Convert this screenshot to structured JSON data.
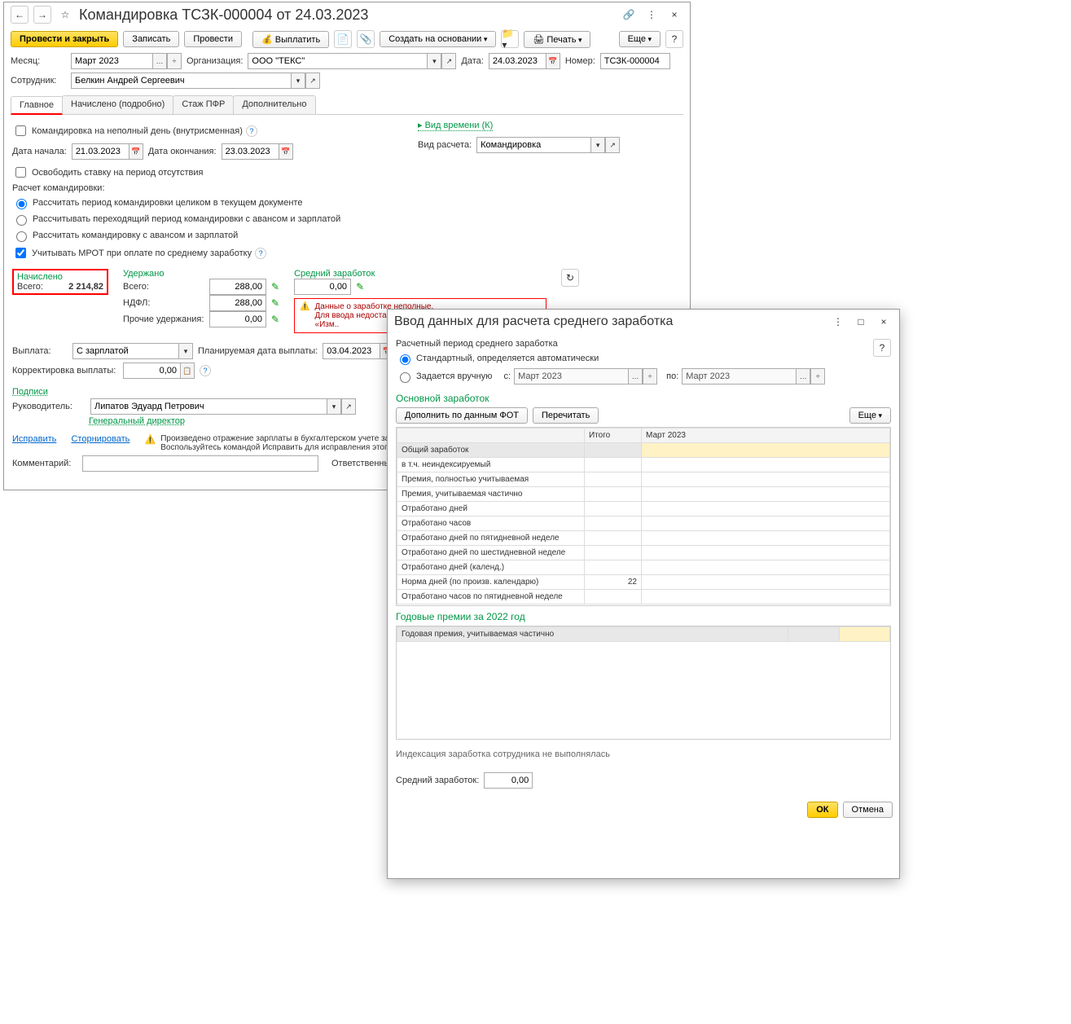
{
  "win1": {
    "title": "Командировка ТСЗК-000004 от 24.03.2023",
    "toolbar": {
      "post_close": "Провести и закрыть",
      "save": "Записать",
      "post": "Провести",
      "pay": "Выплатить",
      "create_based": "Создать на основании",
      "print": "Печать",
      "more": "Еще"
    },
    "header": {
      "month_lbl": "Месяц:",
      "month": "Март 2023",
      "org_lbl": "Организация:",
      "org": "ООО \"ТЕКС\"",
      "date_lbl": "Дата:",
      "date": "24.03.2023",
      "num_lbl": "Номер:",
      "num": "ТСЗК-000004",
      "emp_lbl": "Сотрудник:",
      "emp": "Белкин Андрей Сергеевич"
    },
    "tabs": [
      "Главное",
      "Начислено (подробно)",
      "Стаж ПФР",
      "Дополнительно"
    ],
    "main": {
      "partial_day": "Командировка на неполный день (внутрисменная)",
      "start_lbl": "Дата начала:",
      "start": "21.03.2023",
      "end_lbl": "Дата окончания:",
      "end": "23.03.2023",
      "vac_release": "Освободить ставку на период отсутствия",
      "calc_lbl": "Расчет командировки:",
      "r1": "Рассчитать период командировки целиком в текущем документе",
      "r2": "Рассчитывать переходящий период командировки с авансом и зарплатой",
      "r3": "Рассчитать командировку с авансом и зарплатой",
      "mrot": "Учитывать МРОТ при оплате по среднему заработку",
      "time_type_lbl": "Вид времени (К)",
      "calc_type_lbl": "Вид расчета:",
      "calc_type": "Командировка",
      "accrued": "Начислено",
      "held": "Удержано",
      "avg": "Средний заработок",
      "total_lbl": "Всего:",
      "accrued_val": "2 214,82",
      "held_total": "288,00",
      "ndfl_lbl": "НДФЛ:",
      "ndfl": "288,00",
      "other_lbl": "Прочие удержания:",
      "other": "0,00",
      "avg_val": "0,00",
      "warn1": "Данные о заработке неполные.",
      "warn2": "Для ввода недостающих данных используйте команду «Изм..",
      "payout_lbl": "Выплата:",
      "payout": "С зарплатой",
      "plan_date_lbl": "Планируемая дата выплаты:",
      "plan_date": "03.04.2023",
      "corr_lbl": "Корректировка выплаты:",
      "corr": "0,00",
      "sign_lbl": "Подписи",
      "head_lbl": "Руководитель:",
      "head": "Липатов Эдуард Петрович",
      "head_pos": "Генеральный директор",
      "fix": "Исправить",
      "storno": "Сторнировать",
      "warn3a": "Произведено отражение зарплаты в бухгалтерском учете за М",
      "warn3b": "Воспользуйтесь командой Исправить для исправления этого д",
      "comment_lbl": "Комментарий:",
      "resp_lbl": "Ответственны"
    }
  },
  "win2": {
    "title": "Ввод данных для расчета среднего заработка",
    "period_lbl": "Расчетный период среднего заработка",
    "r1": "Стандартный, определяется автоматически",
    "r2": "Задается вручную",
    "from_lbl": "с:",
    "from": "Март 2023",
    "to_lbl": "по:",
    "to": "Март 2023",
    "section1": "Основной заработок",
    "btn_fill": "Дополнить по данным ФОТ",
    "btn_reread": "Перечитать",
    "more": "Еще",
    "cols": [
      "",
      "Итого",
      "Март 2023"
    ],
    "rows": [
      {
        "label": "Общий заработок",
        "itogo": "",
        "v": "",
        "sel": true
      },
      {
        "label": "    в т.ч. неиндексируемый",
        "itogo": "",
        "v": ""
      },
      {
        "label": "Премия, полностью учитываемая",
        "itogo": "",
        "v": ""
      },
      {
        "label": "Премия, учитываемая частично",
        "itogo": "",
        "v": ""
      },
      {
        "label": "Отработано дней",
        "itogo": "",
        "v": ""
      },
      {
        "label": "Отработано часов",
        "itogo": "",
        "v": ""
      },
      {
        "label": "Отработано дней по пятидневной неделе",
        "itogo": "",
        "v": ""
      },
      {
        "label": "Отработано дней по шестидневной неделе",
        "itogo": "",
        "v": ""
      },
      {
        "label": "Отработано дней (календ.)",
        "itogo": "",
        "v": ""
      },
      {
        "label": "Норма дней (по произв. календарю)",
        "itogo": "22",
        "v": ""
      },
      {
        "label": "Отработано часов по пятидневной неделе",
        "itogo": "",
        "v": ""
      }
    ],
    "section2": "Годовые премии за 2022 год",
    "row2": "Годовая премия, учитываемая частично",
    "index_note": "Индексация заработка сотрудника не выполнялась",
    "avg_lbl": "Средний заработок:",
    "avg": "0,00",
    "ok": "ОК",
    "cancel": "Отмена"
  }
}
